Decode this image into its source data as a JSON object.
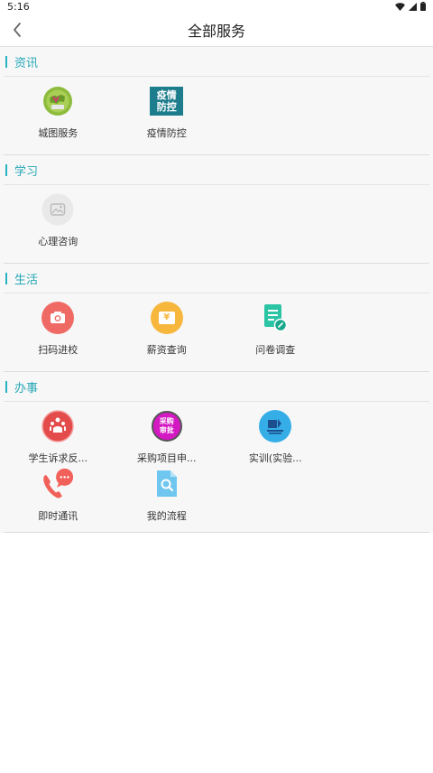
{
  "status_bar": {
    "time": "5:16"
  },
  "header": {
    "title": "全部服务"
  },
  "sections": [
    {
      "title": "资讯",
      "items": [
        {
          "label": "城图服务",
          "icon": "map-globe-icon"
        },
        {
          "label": "疫情防控",
          "icon": "epidemic-control-icon",
          "icon_text_top": "疫情",
          "icon_text_bottom": "防控"
        }
      ]
    },
    {
      "title": "学习",
      "items": [
        {
          "label": "心理咨询",
          "icon": "image-placeholder-icon"
        }
      ]
    },
    {
      "title": "生活",
      "items": [
        {
          "label": "扫码进校",
          "icon": "camera-icon"
        },
        {
          "label": "薪资查询",
          "icon": "folder-yuan-icon",
          "icon_text": "¥"
        },
        {
          "label": "问卷调查",
          "icon": "document-edit-icon"
        }
      ]
    },
    {
      "title": "办事",
      "items": [
        {
          "label": "学生诉求反...",
          "icon": "student-appeal-icon"
        },
        {
          "label": "采购项目申...",
          "icon": "purchase-approval-icon",
          "icon_text_top": "采购",
          "icon_text_bottom": "审批"
        },
        {
          "label": "实训(实验...",
          "icon": "training-lab-icon"
        },
        {
          "label": "即时通讯",
          "icon": "phone-chat-icon"
        },
        {
          "label": "我的流程",
          "icon": "search-document-icon"
        }
      ]
    }
  ],
  "colors": {
    "accent": "#27b3c3"
  }
}
